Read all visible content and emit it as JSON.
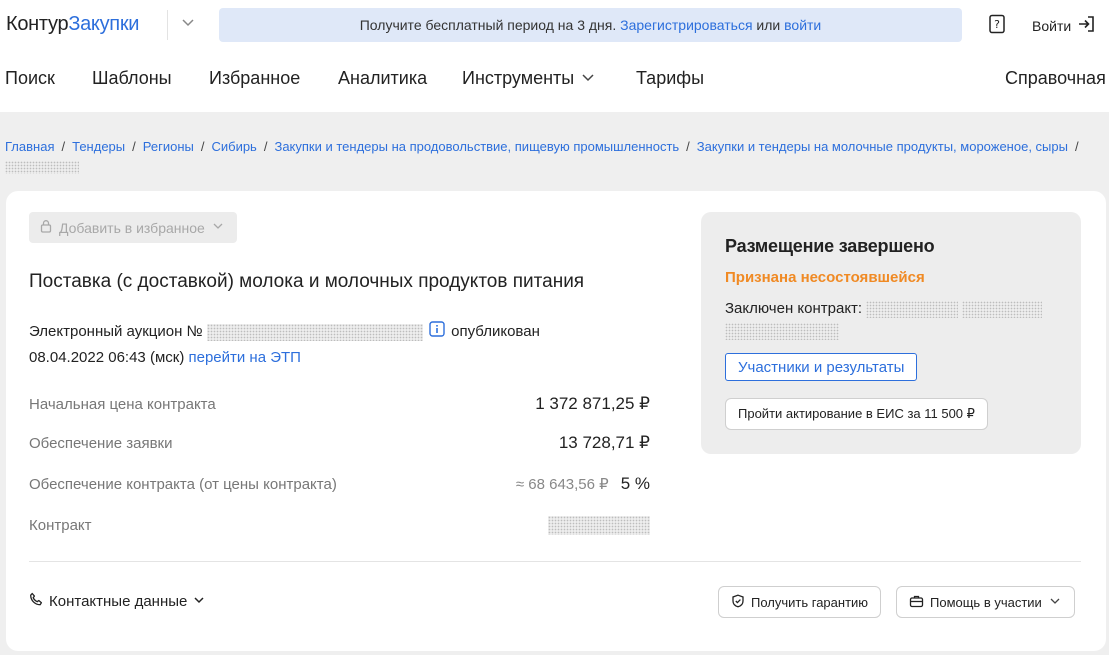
{
  "header": {
    "logo_kontur": "Контур",
    "logo_zakupki": "Закупки",
    "promo_text": "Получите бесплатный период на 3 дня.",
    "promo_register": "Зарегистрироваться",
    "promo_or": "или",
    "promo_login": "войти",
    "login_label": "Войти"
  },
  "nav": {
    "items": [
      "Поиск",
      "Шаблоны",
      "Избранное",
      "Аналитика",
      "Инструменты",
      "Тарифы"
    ],
    "help": "Справочная"
  },
  "breadcrumbs": [
    "Главная",
    "Тендеры",
    "Регионы",
    "Сибирь",
    "Закупки и тендеры на продовольствие, пищевую промышленность",
    "Закупки и тендеры на молочные продукты, мороженое, сыры"
  ],
  "tender": {
    "favorite_label": "Добавить в избранное",
    "title": "Поставка (с доставкой) молока и молочных продуктов питания",
    "auction_prefix": "Электронный аукцион №",
    "published_label": "опубликован",
    "published_date": "08.04.2022 06:43 (мск)",
    "etp_link": "перейти на ЭТП",
    "start_price_label": "Начальная цена контракта",
    "start_price_value": "1 372 871,25 ₽",
    "bid_security_label": "Обеспечение заявки",
    "bid_security_value": "13 728,71 ₽",
    "contract_security_label": "Обеспечение контракта (от цены контракта)",
    "contract_security_approx": "≈ 68 643,56 ₽",
    "contract_security_percent": "5 %",
    "contract_label": "Контракт"
  },
  "status_panel": {
    "title": "Размещение завершено",
    "status": "Признана несостоявшейся",
    "contract_label": "Заключен контракт:",
    "participants_button": "Участники и результаты",
    "actuation_button": "Пройти актирование в ЕИС за 11 500 ₽",
    "status_color": "#f08a24"
  },
  "footer": {
    "contacts_label": "Контактные данные",
    "guarantee_button": "Получить гарантию",
    "help_button": "Помощь в участии"
  },
  "colors": {
    "accent": "#2d6fdc",
    "promo_bg": "#dfe8f8",
    "page_bg": "#efefef"
  }
}
